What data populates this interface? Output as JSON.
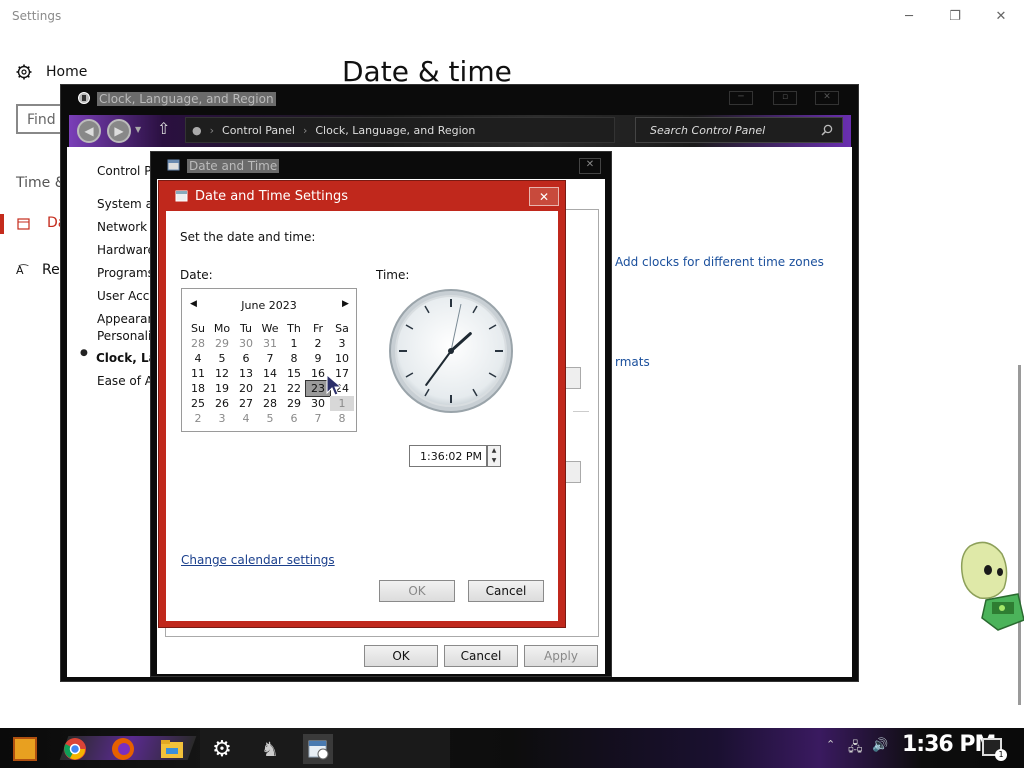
{
  "settings": {
    "title": "Settings",
    "home_label": "Home",
    "find_placeholder": "Find",
    "heading": "Date & time",
    "section_label": "Time &",
    "nav_date_label": "Da",
    "nav_region_label": "Re",
    "controls": {
      "minimize": "─",
      "maximize": "❐",
      "close": "✕"
    }
  },
  "control_panel": {
    "title": "Clock, Language, and Region",
    "path": [
      "Control Panel",
      "Clock, Language, and Region"
    ],
    "search_placeholder": "Search Control Panel",
    "sidebar": [
      {
        "label": "Control Pa"
      },
      {
        "label": "System an"
      },
      {
        "label": "Network a"
      },
      {
        "label": "Hardware"
      },
      {
        "label": "Programs"
      },
      {
        "label": "User Acco"
      },
      {
        "label": "Appearan"
      },
      {
        "label": "Personaliz"
      },
      {
        "label": "Clock, Lan"
      },
      {
        "label": "Ease of A"
      }
    ],
    "link_clocks": "Add clocks for different time zones",
    "link_formats": "rmats"
  },
  "date_time_dialog": {
    "title": "Date and Time",
    "close": "✕",
    "ok": "OK",
    "cancel": "Cancel",
    "apply": "Apply"
  },
  "date_time_settings": {
    "title": "Date and Time Settings",
    "close": "✕",
    "prompt": "Set the date and time:",
    "date_label": "Date:",
    "time_label": "Time:",
    "calendar": {
      "month": "June 2023",
      "prev": "◀",
      "next": "▶",
      "weekdays": [
        "Su",
        "Mo",
        "Tu",
        "We",
        "Th",
        "Fr",
        "Sa"
      ],
      "days": [
        "28",
        "29",
        "30",
        "31",
        "1",
        "2",
        "3",
        "4",
        "5",
        "6",
        "7",
        "8",
        "9",
        "10",
        "11",
        "12",
        "13",
        "14",
        "15",
        "16",
        "17",
        "18",
        "19",
        "20",
        "21",
        "22",
        "23",
        "24",
        "25",
        "26",
        "27",
        "28",
        "29",
        "30",
        "1",
        "2",
        "3",
        "4",
        "5",
        "6",
        "7",
        "8"
      ],
      "other_month_indices": [
        0,
        1,
        2,
        3,
        34,
        35,
        36,
        37,
        38,
        39,
        40,
        41
      ],
      "selected_index": 26,
      "hover_index": 34
    },
    "time_value": "1:36:02 PM",
    "calendar_settings_link": "Change calendar settings",
    "ok": "OK",
    "cancel": "Cancel",
    "clock": {
      "hours": 1,
      "minutes": 36,
      "seconds": 2
    }
  },
  "taskbar": {
    "icons": [
      "game-icon",
      "chrome-icon",
      "firefox-icon",
      "file-explorer-icon",
      "settings-gear-icon",
      "app-icon",
      "date-time-icon"
    ],
    "clock": "1:36 PM",
    "notification_count": "1"
  }
}
